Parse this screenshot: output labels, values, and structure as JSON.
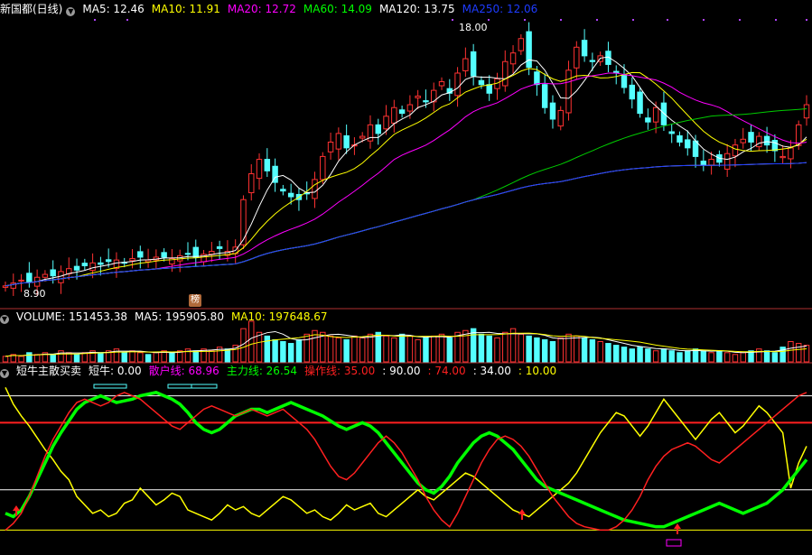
{
  "header": {
    "title": "新国都(日线)",
    "ma": [
      {
        "label": "MA5: 12.46",
        "color": "#ffffff"
      },
      {
        "label": "MA10: 11.91",
        "color": "#ffff00"
      },
      {
        "label": "MA20: 12.72",
        "color": "#ff00ff"
      },
      {
        "label": "MA60: 14.09",
        "color": "#00ff00"
      },
      {
        "label": "MA120: 13.75",
        "color": "#ffffff"
      },
      {
        "label": "MA250: 12.06",
        "color": "#1e3cff"
      }
    ]
  },
  "price_labels": {
    "high": "18.00",
    "low": "8.90"
  },
  "badge": "榜",
  "volume_header": {
    "title": "VOLUME: 151453.38",
    "ma5": "MA5: 195905.80",
    "ma10": "MA10: 197648.67"
  },
  "indicator_header": {
    "title": "短牛主散买卖",
    "items": [
      {
        "label": "短牛: 0.00",
        "color": "#ffffff"
      },
      {
        "label": "散户线: 68.96",
        "color": "#ff00ff"
      },
      {
        "label": "主力线: 26.54",
        "color": "#00ff00"
      },
      {
        "label": "操作线: 35.00",
        "color": "#ff2020"
      },
      {
        "label": ": 90.00",
        "color": "#ffffff"
      },
      {
        "label": ": 74.00",
        "color": "#ff2020"
      },
      {
        "label": ": 34.00",
        "color": "#ffffff"
      },
      {
        "label": ": 10.00",
        "color": "#ffff00"
      }
    ]
  },
  "chart_data": [
    {
      "type": "candlestick",
      "title": "新国都(日线)",
      "price_range": [
        8.9,
        18.0
      ],
      "high": 18.0,
      "low": 8.9,
      "up_color": "#ff3232",
      "down_color": "#54ffff",
      "closes": [
        9.0,
        9.1,
        9.2,
        9.15,
        9.3,
        9.4,
        9.35,
        9.5,
        9.6,
        9.55,
        9.7,
        9.8,
        9.75,
        9.85,
        9.9,
        9.8,
        9.95,
        10.0,
        9.9,
        10.0,
        10.0,
        9.95,
        10.05,
        10.1,
        10.0,
        10.1,
        10.2,
        10.3,
        10.2,
        10.35,
        12.0,
        12.9,
        13.4,
        13.0,
        12.6,
        12.3,
        12.1,
        12.0,
        12.2,
        12.7,
        13.5,
        14.0,
        14.3,
        13.8,
        13.9,
        14.2,
        14.6,
        14.3,
        14.9,
        15.2,
        15.0,
        15.3,
        15.6,
        15.4,
        15.8,
        16.1,
        15.7,
        16.4,
        16.9,
        16.3,
        16.0,
        15.7,
        16.2,
        16.8,
        17.1,
        17.6,
        16.6,
        16.0,
        15.2,
        14.8,
        15.1,
        16.5,
        17.3,
        17.0,
        16.8,
        17.0,
        16.7,
        16.4,
        15.9,
        15.5,
        15.0,
        14.7,
        15.2,
        14.6,
        14.3,
        14.0,
        13.8,
        13.5,
        13.2,
        13.4,
        13.3,
        13.6,
        13.9,
        14.1,
        14.0,
        14.2,
        13.9,
        13.7,
        13.5,
        13.8,
        14.6,
        15.3
      ],
      "ma": [
        {
          "name": "MA5",
          "last": 12.46
        },
        {
          "name": "MA10",
          "last": 11.91
        },
        {
          "name": "MA20",
          "last": 12.72
        },
        {
          "name": "MA60",
          "last": 14.09
        },
        {
          "name": "MA120",
          "last": 13.75
        },
        {
          "name": "MA250",
          "last": 12.06
        }
      ]
    },
    {
      "type": "bar",
      "title": "VOLUME",
      "last": 151453.38,
      "ma5": 195905.8,
      "ma10": 197648.67,
      "values": [
        3,
        4,
        3,
        5,
        4,
        5,
        4,
        6,
        5,
        4,
        5,
        6,
        5,
        6,
        7,
        5,
        6,
        5,
        4,
        5,
        6,
        5,
        6,
        7,
        6,
        7,
        6,
        8,
        7,
        9,
        18,
        22,
        16,
        14,
        12,
        11,
        10,
        12,
        15,
        17,
        16,
        14,
        13,
        12,
        14,
        13,
        15,
        16,
        14,
        13,
        15,
        14,
        12,
        13,
        14,
        15,
        13,
        16,
        17,
        18,
        15,
        14,
        13,
        16,
        18,
        15,
        14,
        13,
        12,
        11,
        13,
        15,
        14,
        13,
        12,
        11,
        10,
        9,
        8,
        7,
        8,
        7,
        6,
        7,
        6,
        5,
        6,
        7,
        6,
        5,
        6,
        5,
        4,
        5,
        6,
        7,
        6,
        5,
        8,
        11,
        10,
        9
      ]
    },
    {
      "type": "line",
      "title": "短牛主散买卖",
      "ylim": [
        0,
        100
      ],
      "reference_lines": [
        90,
        74,
        34,
        10
      ],
      "series": [
        {
          "name": "散户线",
          "color": "#ffff00",
          "values": [
            95,
            85,
            78,
            72,
            65,
            58,
            52,
            45,
            40,
            30,
            25,
            20,
            22,
            18,
            20,
            26,
            28,
            35,
            30,
            25,
            28,
            32,
            30,
            22,
            20,
            18,
            16,
            20,
            25,
            22,
            24,
            20,
            18,
            22,
            26,
            30,
            28,
            24,
            20,
            22,
            18,
            16,
            20,
            25,
            22,
            24,
            26,
            20,
            18,
            22,
            26,
            30,
            34,
            30,
            28,
            32,
            36,
            40,
            44,
            42,
            38,
            34,
            30,
            26,
            22,
            20,
            18,
            22,
            26,
            30,
            34,
            38,
            44,
            52,
            60,
            68,
            74,
            80,
            78,
            72,
            66,
            72,
            80,
            88,
            82,
            76,
            70,
            64,
            70,
            76,
            80,
            74,
            68,
            72,
            78,
            84,
            80,
            74,
            68,
            35,
            50,
            60
          ]
        },
        {
          "name": "主力线",
          "color": "#00ff00",
          "values": [
            20,
            18,
            22,
            30,
            40,
            50,
            60,
            68,
            75,
            82,
            86,
            88,
            90,
            88,
            86,
            87,
            88,
            90,
            91,
            92,
            90,
            88,
            85,
            80,
            74,
            70,
            68,
            70,
            74,
            78,
            80,
            82,
            82,
            80,
            82,
            84,
            86,
            84,
            82,
            80,
            78,
            75,
            72,
            70,
            72,
            74,
            72,
            68,
            62,
            56,
            50,
            44,
            38,
            34,
            32,
            36,
            42,
            50,
            56,
            62,
            66,
            68,
            66,
            62,
            58,
            52,
            46,
            40,
            36,
            34,
            32,
            30,
            28,
            26,
            24,
            22,
            20,
            18,
            16,
            15,
            14,
            13,
            12,
            12,
            14,
            16,
            18,
            20,
            22,
            24,
            26,
            24,
            22,
            20,
            22,
            24,
            26,
            30,
            34,
            40,
            46,
            52
          ]
        },
        {
          "name": "操作线",
          "color": "#ff2020",
          "values": [
            10,
            14,
            20,
            30,
            42,
            54,
            64,
            72,
            80,
            86,
            88,
            86,
            84,
            86,
            90,
            92,
            90,
            88,
            84,
            80,
            76,
            72,
            70,
            74,
            78,
            82,
            84,
            82,
            80,
            78,
            80,
            82,
            80,
            78,
            80,
            82,
            78,
            74,
            70,
            64,
            56,
            48,
            42,
            40,
            44,
            50,
            56,
            62,
            66,
            62,
            56,
            48,
            40,
            30,
            22,
            16,
            12,
            20,
            30,
            40,
            50,
            58,
            64,
            66,
            64,
            60,
            54,
            46,
            38,
            30,
            24,
            18,
            14,
            12,
            11,
            10,
            10,
            12,
            16,
            22,
            30,
            40,
            48,
            54,
            58,
            60,
            62,
            60,
            56,
            52,
            50,
            54,
            58,
            62,
            66,
            70,
            74,
            78,
            82,
            86,
            90,
            92
          ]
        }
      ]
    }
  ]
}
